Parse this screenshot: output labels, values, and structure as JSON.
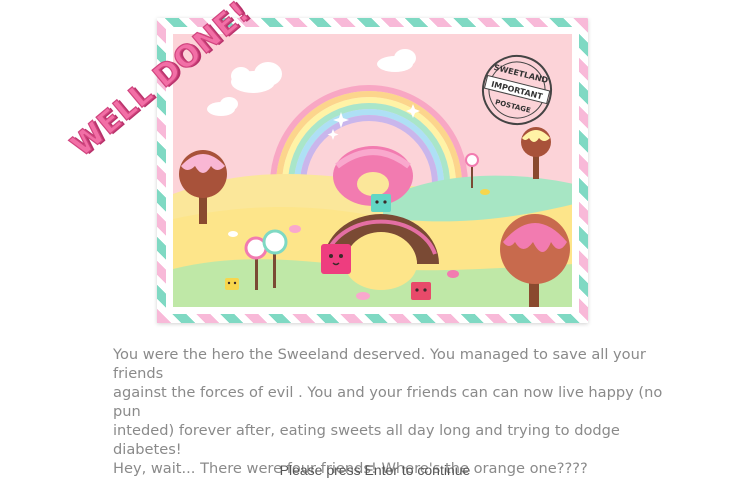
{
  "banner": {
    "headline": "WELL DONE!"
  },
  "stamp": {
    "top_text": "SWEETLAND",
    "middle_text": "IMPORTANT",
    "bottom_text": "POSTAGE"
  },
  "story": {
    "lines": [
      "You were the hero the Sweeland deserved. You managed to save all your friends",
      "against the forces of evil . You and your friends can can now live happy (no pun",
      "inteded) forever after, eating sweets all day long and trying to dodge diabetes!",
      "Hey, wait... There were four friends! Where's the orange one????"
    ]
  },
  "prompt": {
    "continue_text": "Please press Enter to continue"
  },
  "colors": {
    "headline": "#f26fa6",
    "stripe_pink": "#f8b9d8",
    "stripe_teal": "#7fd9c3",
    "sky": "#fcd3d8",
    "body_text": "#8a8a8a"
  }
}
